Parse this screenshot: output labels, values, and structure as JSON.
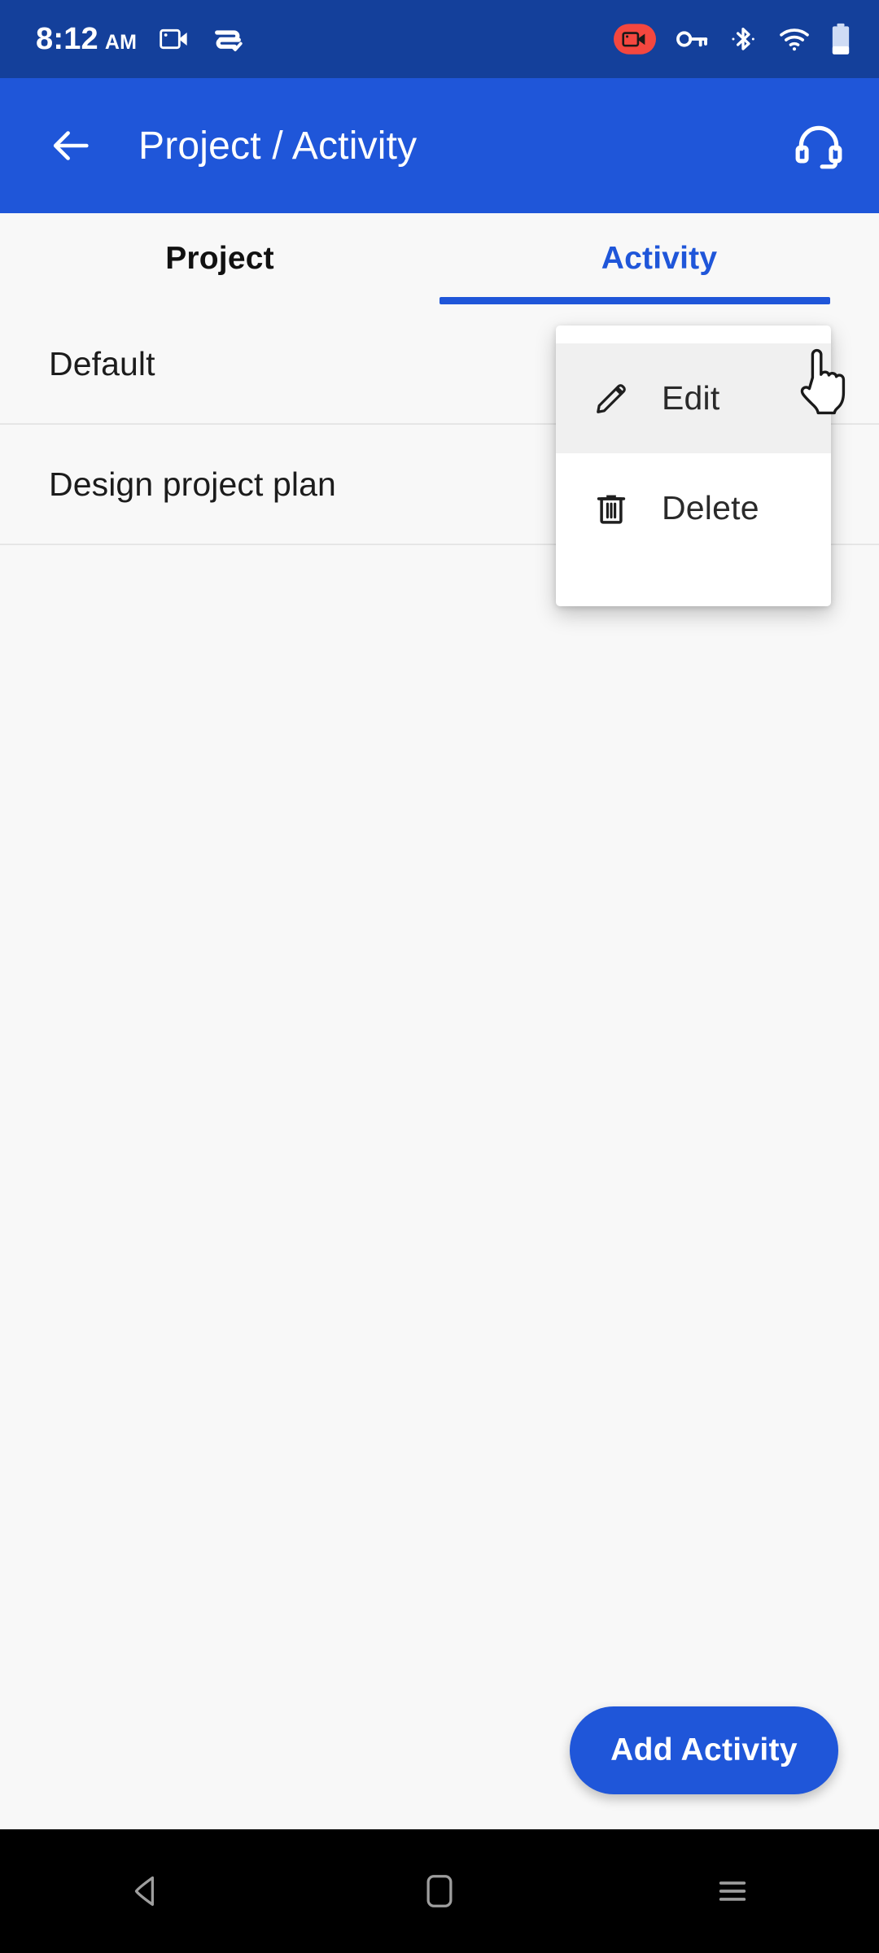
{
  "status_bar": {
    "time": "8:12",
    "ampm": "AM",
    "background_color": "#14409b",
    "left_icons": [
      {
        "name": "screen-record-icon"
      },
      {
        "name": "data-saver-check-icon"
      }
    ],
    "right_icons": [
      {
        "name": "screen-recording-badge-icon",
        "color": "#f4473f"
      },
      {
        "name": "vpn-key-icon"
      },
      {
        "name": "bluetooth-icon"
      },
      {
        "name": "wifi-icon"
      },
      {
        "name": "battery-icon"
      }
    ]
  },
  "app_bar": {
    "title": "Project / Activity",
    "back_icon": "arrow-back-icon",
    "support_icon": "headset-support-icon",
    "background_color": "#1f56d9"
  },
  "tabs": [
    {
      "label": "Project",
      "active": false
    },
    {
      "label": "Activity",
      "active": true
    }
  ],
  "accent_color": "#1f56d9",
  "activity_list": [
    {
      "label": "Default"
    },
    {
      "label": "Design project plan"
    }
  ],
  "context_menu": {
    "items": [
      {
        "label": "Edit",
        "icon": "pencil-edit-icon",
        "highlighted": true
      },
      {
        "label": "Delete",
        "icon": "trash-delete-icon",
        "highlighted": false
      }
    ]
  },
  "fab": {
    "label": "Add Activity"
  },
  "nav_bar": {
    "buttons": [
      {
        "name": "nav-back-button",
        "icon": "triangle-back-icon"
      },
      {
        "name": "nav-home-button",
        "icon": "rounded-square-home-icon"
      },
      {
        "name": "nav-recents-button",
        "icon": "hamburger-recents-icon"
      }
    ]
  }
}
